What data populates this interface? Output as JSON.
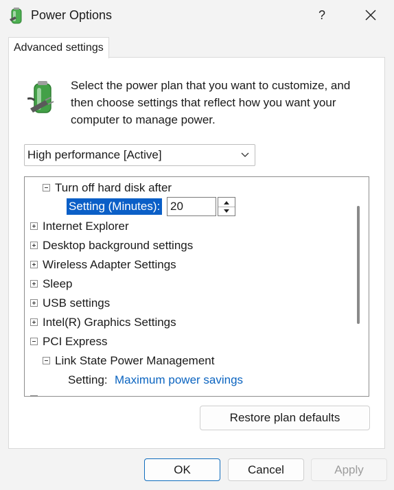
{
  "window": {
    "title": "Power Options",
    "help_label": "?",
    "icons": {
      "app": "power-options-icon",
      "close": "close-icon"
    }
  },
  "tabs": [
    {
      "label": "Advanced settings",
      "active": true
    }
  ],
  "intro": {
    "icon": "battery-plug-icon",
    "text": "Select the power plan that you want to customize, and then choose settings that reflect how you want your computer to manage power."
  },
  "plan_select": {
    "value": "High performance [Active]"
  },
  "settings_tree": {
    "hard_disk": {
      "label": "Turn off hard disk after",
      "expanded": true
    },
    "minutes_setting": {
      "label": "Setting (Minutes):",
      "value": "20"
    },
    "collapsed_groups": [
      "Internet Explorer",
      "Desktop background settings",
      "Wireless Adapter Settings",
      "Sleep",
      "USB settings",
      "Intel(R) Graphics Settings"
    ],
    "pci_express": {
      "label": "PCI Express",
      "expanded": true
    },
    "link_state": {
      "label": "Link State Power Management",
      "expanded": true
    },
    "link_state_setting": {
      "label": "Setting:",
      "value": "Maximum power savings"
    }
  },
  "buttons": {
    "restore": "Restore plan defaults",
    "ok": "OK",
    "cancel": "Cancel",
    "apply": "Apply"
  },
  "colors": {
    "accent": "#0f6cbd",
    "selection": "#0b5fc7",
    "link": "#0b64c0",
    "window_bg": "#f3f3f3"
  }
}
